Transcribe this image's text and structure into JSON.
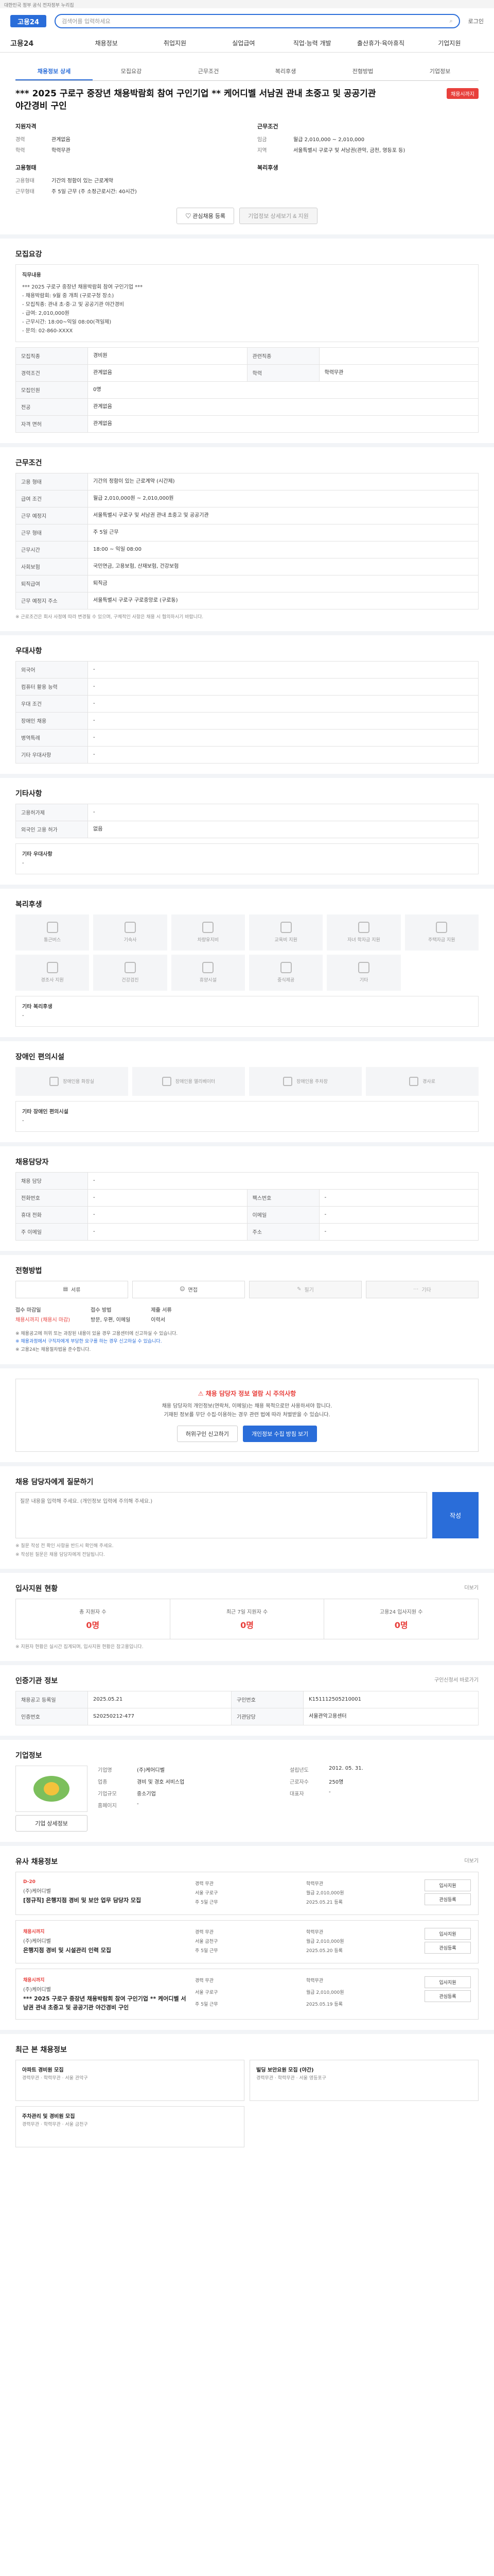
{
  "banner": "대한민국 정부 공식 전자정부 누리집",
  "header": {
    "logo": "고용24",
    "search_placeholder": "검색어를 입력하세요",
    "login": "로그인"
  },
  "gnb": {
    "home": "고용24",
    "items": [
      "채용정보",
      "취업지원",
      "실업급여",
      "직업·능력 개발",
      "출산휴가·육아휴직",
      "기업지원"
    ]
  },
  "tabs": [
    "채용정보 상세",
    "모집요강",
    "근무조건",
    "복리후생",
    "전형방법",
    "기업정보"
  ],
  "job": {
    "title": "*** 2025 구로구 중장년 채용박람회 참여 구인기업 ** 케어디벨 서남권 관내 초중고 및 공공기관 야간경비 구인",
    "dday": "채용시까지",
    "summary_left_title": "지원자격",
    "summary_left": [
      {
        "k": "경력",
        "v": "관계없음"
      },
      {
        "k": "학력",
        "v": "학력무관"
      }
    ],
    "summary_right_title": "근무조건",
    "summary_right": [
      {
        "k": "임금",
        "v": "월급 2,010,000 ~ 2,010,000"
      },
      {
        "k": "지역",
        "v": "서울특별시 구로구 및 서남권(관악, 금천, 영등포 등)"
      }
    ],
    "summary_left2_title": "고용형태",
    "summary_left2": [
      {
        "k": "고용형태",
        "v": "기간의 정함이 있는 근로계약"
      },
      {
        "k": "근무형태",
        "v": "주 5일 근무 (주 소정근로시간: 40시간)"
      }
    ],
    "summary_right2_title": "복리후생",
    "summary_right2": [],
    "btn_interest": "관심채용 등록",
    "btn_apply": "기업정보 상세보기 & 지원"
  },
  "recruit": {
    "title": "모집요강",
    "work_content_label": "직무내용",
    "work_content": "*** 2025 구로구 중장년 채용박람회 참여 구인기업 ***\n - 채용박람회: 9월 중 개최 (구로구청 장소)\n - 모집직종: 관내 초·중·고 및 공공기관 야간경비\n - 급여: 2,010,000원\n - 근무시간: 18:00~익일 08:00(격일제)\n - 문의: 02-860-XXXX",
    "rows": [
      {
        "k1": "모집직종",
        "v1": "경비원",
        "k2": "관련직종",
        "v2": ""
      },
      {
        "k1": "직무내용",
        "v1": "",
        "k2": "",
        "v2": ""
      },
      {
        "k1": "경력조건",
        "v1": "관계없음",
        "k2": "학력",
        "v2": "학력무관"
      },
      {
        "k1": "모집인원",
        "v1": "0명",
        "k2": "",
        "v2": ""
      },
      {
        "k1": "전공",
        "v1": "관계없음",
        "k2": "",
        "v2": ""
      },
      {
        "k1": "자격 면허",
        "v1": "관계없음",
        "k2": "",
        "v2": ""
      }
    ]
  },
  "condition": {
    "title": "근무조건",
    "rows": [
      {
        "k": "고용 형태",
        "v": "기간의 정함이 있는 근로계약 (시간제)"
      },
      {
        "k": "급여 조건",
        "v": "월급 2,010,000원 ~ 2,010,000원"
      },
      {
        "k": "근무 예정지",
        "v": "서울특별시 구로구 및 서남권 관내 초중고 및 공공기관"
      },
      {
        "k": "근무 형태",
        "v": "주 5일 근무"
      },
      {
        "k": "근무시간",
        "v": "18:00 ~ 익일 08:00"
      },
      {
        "k": "사회보험",
        "v": "국민연금, 고용보험, 산재보험, 건강보험"
      },
      {
        "k": "퇴직급여",
        "v": "퇴직금"
      },
      {
        "k": "근무 예정지 주소",
        "v": "서울특별시 구로구 구로중앙로 (구로동)"
      }
    ],
    "note": "※ 근로조건은 회사 사정에 따라 변경될 수 있으며, 구체적인 사항은 채용 시 협의하시기 바랍니다."
  },
  "pref": {
    "title": "우대사항",
    "rows": [
      {
        "k": "외국어",
        "v": "-"
      },
      {
        "k": "컴퓨터 활용 능력",
        "v": "-"
      },
      {
        "k": "우대 조건",
        "v": "-"
      },
      {
        "k": "장애인 채용",
        "v": "-"
      },
      {
        "k": "병역특례",
        "v": "-"
      },
      {
        "k": "기타 우대사항",
        "v": "-"
      }
    ]
  },
  "other": {
    "title": "기타사항",
    "rows": [
      {
        "k": "고용허가제",
        "v": "-"
      },
      {
        "k": "외국인 고용 허가",
        "v": "없음"
      }
    ],
    "etc_label": "기타 우대사항",
    "etc": "-"
  },
  "welfare": {
    "title": "복리후생",
    "items": [
      "통근버스",
      "기숙사",
      "차량유지비",
      "교육비 지원",
      "자녀 학자금 지원",
      "주택자금 지원",
      "경조사 지원",
      "건강검진",
      "휴양시설",
      "중식제공",
      "기타"
    ],
    "etc_label": "기타 복리후생",
    "etc": "-"
  },
  "disability": {
    "title": "장애인 편의시설",
    "items": [
      "장애인용 화장실",
      "장애인용 엘리베이터",
      "장애인용 주차장",
      "경사로"
    ],
    "etc_label": "기타 장애인 편의시설",
    "etc": "-"
  },
  "manager": {
    "title": "채용담당자",
    "rows": [
      {
        "k1": "채용 담당",
        "v1": "-",
        "k2": "",
        "v2": ""
      },
      {
        "k1": "전화번호",
        "v1": "-",
        "k2": "팩스번호",
        "v2": "-"
      },
      {
        "k1": "휴대 전화",
        "v1": "-",
        "k2": "이메일",
        "v2": "-"
      },
      {
        "k1": "주 이메일",
        "v1": "-",
        "k2": "주소",
        "v2": "-"
      }
    ]
  },
  "selection": {
    "title": "전형방법",
    "methods": [
      "서류",
      "면접",
      "필기",
      "기타"
    ],
    "deadline_label": "접수 마감일",
    "deadline": "채용시까지 (채용시 마감)",
    "method_label": "접수 방법",
    "method": "방문, 우편, 이메일",
    "doc_label": "제출 서류",
    "doc": "이력서",
    "warn1": "※ 채용공고에 허위 또는 과장된 내용이 있을 경우 고용센터에 신고하실 수 있습니다.",
    "warn2": "※ 채용과정에서 구직자에게 부당한 요구를 하는 경우 신고하실 수 있습니다.",
    "warn3": "※ 고용24는 채용절차법을 준수합니다."
  },
  "report": {
    "title": "채용 담당자 정보 열람 시 주의사항",
    "text1": "채용 담당자의 개인정보(연락처, 이메일)는 채용 목적으로만 사용하셔야 합니다.",
    "text2": "기재된 정보를 무단 수집·이용하는 경우 관련 법에 따라 처벌받을 수 있습니다.",
    "btn_report": "허위구인 신고하기",
    "btn_faq": "개인정보 수집 방침 보기"
  },
  "qna": {
    "title": "채용 담당자에게 질문하기",
    "placeholder": "질문 내용을 입력해 주세요. (개인정보 입력에 주의해 주세요.)",
    "submit": "작성",
    "notes": "※ 질문 작성 전 확인 사항을 반드시 확인해 주세요.",
    "notes2": "※ 작성된 질문은 채용 담당자에게 전달됩니다."
  },
  "stats": {
    "title": "입사지원 현황",
    "more": "더보기",
    "items": [
      {
        "label": "총 지원자 수",
        "num": "0명"
      },
      {
        "label": "최근 7일 지원자 수",
        "num": "0명"
      },
      {
        "label": "고용24 입사지원 수",
        "num": "0명"
      }
    ],
    "note": "※ 지원자 현황은 실시간 집계되며, 입사지원 현황은 참고용입니다."
  },
  "reg": {
    "title": "인증기관 정보",
    "more": "구인신청서 바로가기",
    "rows": [
      {
        "k1": "채용공고 등록일",
        "v1": "2025.05.21",
        "k2": "구인번호",
        "v2": "K151112505210001"
      },
      {
        "k1": "인증번호",
        "v1": "S20250212-477",
        "k2": "기관담당",
        "v2": "서울관악고용센터"
      }
    ]
  },
  "company": {
    "title": "기업정보",
    "name_label": "기업명",
    "name": "(주)케어디벨",
    "industry_label": "업종",
    "industry": "경비 및 경호 서비스업",
    "size_label": "기업규모",
    "size": "중소기업",
    "est_label": "설립년도",
    "est": "2012. 05. 31.",
    "emp_label": "근로자수",
    "emp": "250명",
    "ceo_label": "대표자",
    "ceo": "-",
    "homepage_label": "홈페이지",
    "homepage": "-",
    "btn_more": "기업 상세정보"
  },
  "similar": {
    "title": "유사 채용정보",
    "more": "더보기",
    "items": [
      {
        "badge": "D-20",
        "name": "(주)케어디벨",
        "title": "[정규직] 은행지점 경비 및 보안 업무 담당자 모집",
        "meta": [
          "경력 무관",
          "학력무관",
          "서울 구로구",
          "월급 2,010,000원",
          "주 5일 근무",
          "2025.05.21 등록"
        ]
      },
      {
        "badge": "채용시까지",
        "name": "(주)케어디벨",
        "title": "은행지점 경비 및 시설관리 인력 모집",
        "meta": [
          "경력 무관",
          "학력무관",
          "서울 금천구",
          "월급 2,010,000원",
          "주 5일 근무",
          "2025.05.20 등록"
        ]
      },
      {
        "badge": "채용시까지",
        "name": "(주)케어디벨",
        "title": "*** 2025 구로구 중장년 채용박람회 참여 구인기업 ** 케어디벨 서남권 관내 초중고 및 공공기관 야간경비 구인",
        "meta": [
          "경력 무관",
          "학력무관",
          "서울 구로구",
          "월급 2,010,000원",
          "주 5일 근무",
          "2025.05.19 등록"
        ]
      }
    ],
    "btn_apply": "입사지원",
    "btn_interest": "관심등록"
  },
  "viewed": {
    "title": "최근 본 채용정보",
    "items": [
      {
        "title": "아파트 경비원 모집",
        "meta": "경력무관 · 학력무관 · 서울 관악구"
      },
      {
        "title": "빌딩 보안요원 모집 (야간)",
        "meta": "경력무관 · 학력무관 · 서울 영등포구"
      },
      {
        "title": "주차관리 및 경비원 모집",
        "meta": "경력무관 · 학력무관 · 서울 금천구"
      }
    ]
  }
}
